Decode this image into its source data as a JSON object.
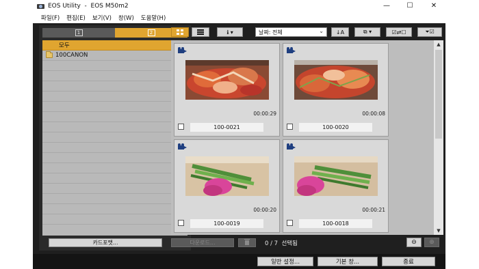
{
  "window": {
    "title": "EOS Utility  -  EOS M50m2",
    "minimize_glyph": "—",
    "maximize_glyph": "☐",
    "close_glyph": "✕"
  },
  "menu": [
    "파일(F)",
    "편집(E)",
    "보기(V)",
    "창(W)",
    "도움말(H)"
  ],
  "card_tabs": [
    "1",
    "2"
  ],
  "tree": {
    "all_label": "모두",
    "folder_label": "100CANON"
  },
  "card_format_label": "카드포맷...",
  "toolbar": {
    "sort_value": "날짜: 전체",
    "sort_chevron": "⌄",
    "info_label": "ℹ ▾",
    "sort_dir_label": "↓A",
    "group_label": "⧉ ▾",
    "select_label": "☑⇄☐",
    "filter_label": "⏷☑"
  },
  "thumbnails": [
    {
      "file": "100-0021",
      "duration": "00:00:29",
      "checked": false,
      "type": "movie"
    },
    {
      "file": "100-0020",
      "duration": "00:00:08",
      "checked": false,
      "type": "movie"
    },
    {
      "file": "100-0019",
      "duration": "00:00:20",
      "checked": false,
      "type": "movie"
    },
    {
      "file": "100-0018",
      "duration": "00:00:21",
      "checked": false,
      "type": "movie"
    }
  ],
  "scroll": {
    "up": "▲",
    "down": "▼"
  },
  "bottom": {
    "download_label": "다운로드...",
    "selection_text": "0 / 7  선택됨",
    "zoom_out": "⊖",
    "zoom_in": "⊕"
  },
  "footer": {
    "preferences_label": "일반 설정...",
    "main_window_label": "기본 창...",
    "quit_label": "종료"
  },
  "splitter_grip": "⁞",
  "colors": {
    "accent": "#e0a530",
    "panel_bg": "#1f1f1f",
    "thumb_area_bg": "#bdbdbd",
    "movie_icon": "#1f3f80"
  }
}
